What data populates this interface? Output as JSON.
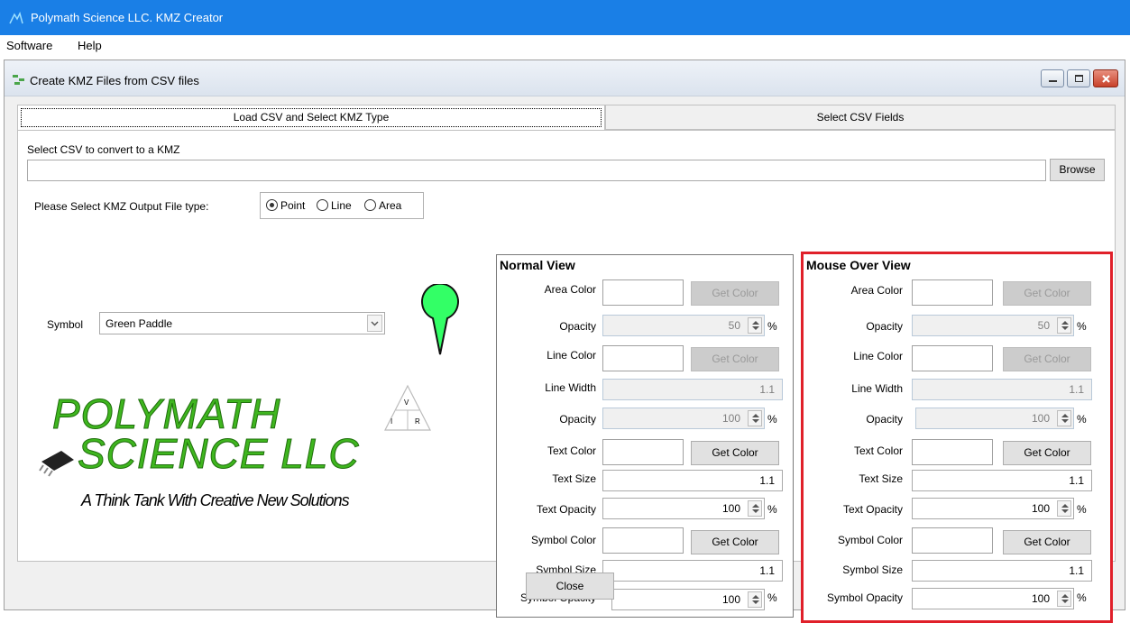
{
  "app": {
    "title": "Polymath Science LLC. KMZ Creator"
  },
  "menu": [
    "Software",
    "Help"
  ],
  "child_window": {
    "title": "Create KMZ Files from CSV files"
  },
  "tabs": [
    "Load CSV and Select KMZ Type",
    "Select CSV Fields"
  ],
  "csv": {
    "label": "Select CSV to convert to a KMZ",
    "value": "",
    "browse": "Browse"
  },
  "output_type": {
    "label": "Please Select KMZ Output File type:",
    "options": [
      "Point",
      "Line",
      "Area"
    ],
    "selected": "Point"
  },
  "symbol": {
    "label": "Symbol",
    "value": "Green Paddle",
    "color": "#33ff66"
  },
  "logo": {
    "line1": "POLYMATH",
    "line2": "SCIENCE LLC",
    "tagline": "A Think Tank With Creative New Solutions",
    "triangle": [
      "V",
      "I",
      "R"
    ]
  },
  "labels": {
    "area_color": "Area Color",
    "opacity": "Opacity",
    "line_color": "Line Color",
    "line_width": "Line Width",
    "text_color": "Text Color",
    "text_size": "Text Size",
    "text_opacity": "Text Opacity",
    "symbol_color": "Symbol Color",
    "symbol_size": "Symbol Size",
    "symbol_opacity": "Symbol Opacity",
    "get_color": "Get Color",
    "percent": "%"
  },
  "normal_view": {
    "title": "Normal View",
    "area_opacity": "50",
    "line_width": "1.1",
    "line_opacity": "100",
    "text_size": "1.1",
    "text_opacity": "100",
    "symbol_size": "1.1",
    "symbol_opacity": "100"
  },
  "mouse_over_view": {
    "title": "Mouse Over View",
    "area_opacity": "50",
    "line_width": "1.1",
    "line_opacity": "100",
    "text_size": "1.1",
    "text_opacity": "100",
    "symbol_size": "1.1",
    "symbol_opacity": "100"
  },
  "close_button": "Close",
  "colors": {
    "titlebar": "#1a7fe6",
    "highlight": "#e0202a",
    "logo_green": "#3fb61f"
  }
}
